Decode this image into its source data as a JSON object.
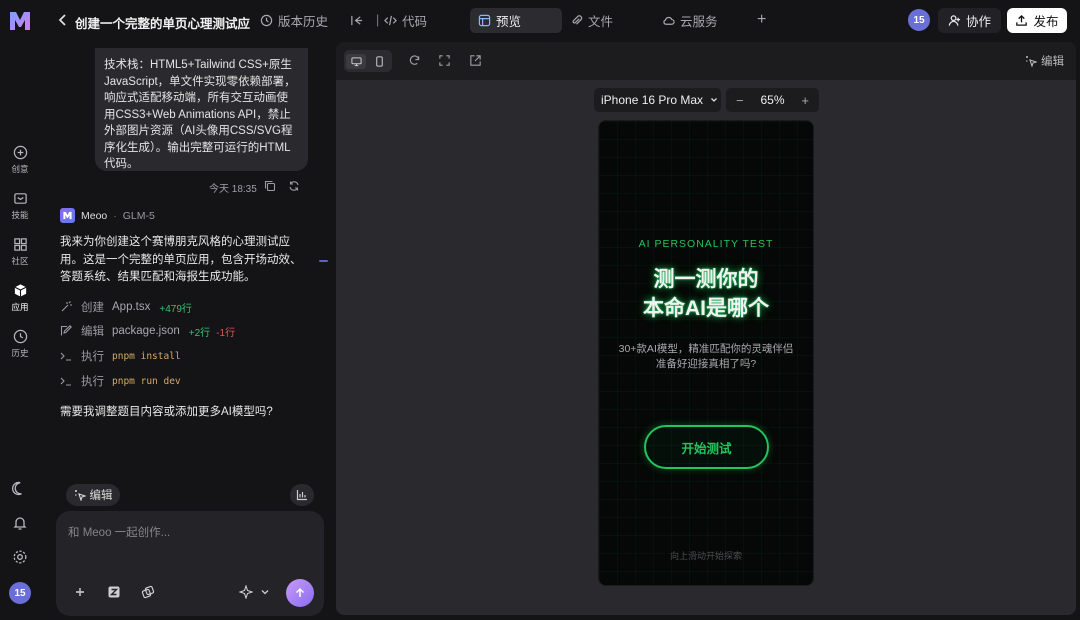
{
  "header": {
    "project_title": "创建一个完整的单页心理测试应",
    "version_history": "版本历史",
    "code": "代码",
    "preview": "预览",
    "files": "文件",
    "cloud": "云服务",
    "user_badge": "15",
    "collab": "协作",
    "publish": "发布"
  },
  "rail": {
    "items": [
      {
        "label": "创意",
        "icon": "plus-circle-icon"
      },
      {
        "label": "技能",
        "icon": "briefcase-icon"
      },
      {
        "label": "社区",
        "icon": "grid-icon"
      },
      {
        "label": "应用",
        "icon": "cube-icon"
      },
      {
        "label": "历史",
        "icon": "clock-icon"
      }
    ],
    "avatar": "15"
  },
  "chat": {
    "user_message": "技术栈：HTML5+Tailwind CSS+原生JavaScript，单文件实现零依赖部署，响应式适配移动端，所有交互动画使用CSS3+Web Animations API，禁止外部图片资源（AI头像用CSS/SVG程序化生成）。输出完整可运行的HTML代码。",
    "time": "今天 18:35",
    "bot_name": "Meoo",
    "bot_model": "GLM-5",
    "bot_text": "我来为你创建这个赛博朋克风格的心理测试应用。这是一个完整的单页应用，包含开场动效、答题系统、结果匹配和海报生成功能。",
    "steps": [
      {
        "verb": "创建",
        "file": "App.tsx",
        "add": "+479行"
      },
      {
        "verb": "编辑",
        "file": "package.json",
        "add": "+2行",
        "del": "-1行"
      },
      {
        "verb": "执行",
        "cmd": "pnpm install"
      },
      {
        "verb": "执行",
        "cmd": "pnpm run dev"
      }
    ],
    "question": "需要我调整题目内容或添加更多AI模型吗?",
    "edit_chip": "编辑",
    "composer_placeholder": "和 Meoo 一起创作..."
  },
  "preview": {
    "edit": "编辑",
    "device": "iPhone 16 Pro Max",
    "zoom": "65%",
    "zoom_minus": "−",
    "zoom_plus": "+"
  },
  "phone": {
    "subtitle": "AI PERSONALITY TEST",
    "title_line1": "测一测你的",
    "title_line2": "本命AI是哪个",
    "desc_line1": "30+款AI模型，精准匹配你的灵魂伴侣",
    "desc_line2": "准备好迎接真相了吗?",
    "start": "开始测试",
    "hint": "向上滑动开始探索"
  },
  "colors": {
    "accent_green": "#22c55e",
    "avatar_purple": "#6a6fd8",
    "background": "#141416"
  }
}
